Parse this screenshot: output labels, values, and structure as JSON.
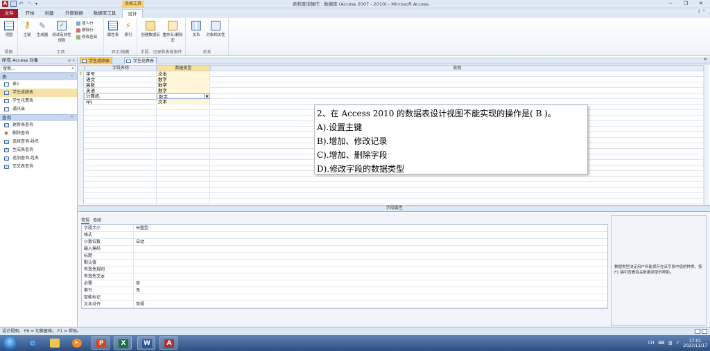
{
  "window": {
    "title": "表和查询操作 : 数据库 (Access 2007 - 2010) - Microsoft Access",
    "context_tab_group": "表格工具",
    "app_letter": "A"
  },
  "ribbon_tabs": [
    "文件",
    "开始",
    "创建",
    "外部数据",
    "数据库工具",
    "设计"
  ],
  "ribbon": {
    "groups": [
      {
        "label": "视图",
        "buttons": [
          "视图"
        ]
      },
      {
        "label": "工具",
        "buttons": [
          "主键",
          "生成器",
          "测试有效性规则"
        ],
        "small": [
          "插入行",
          "删除行",
          "修改查阅"
        ]
      },
      {
        "label": "显示/隐藏",
        "buttons": [
          "属性表",
          "索引"
        ]
      },
      {
        "label": "字段、记录和表格事件",
        "buttons": [
          "创建数据宏",
          "重命名/删除宏"
        ]
      },
      {
        "label": "关系",
        "buttons": [
          "关系",
          "对象相关性"
        ]
      }
    ]
  },
  "nav": {
    "header": "所有 Access 对象",
    "search_placeholder": "搜索...",
    "sections": [
      {
        "title": "表",
        "items": [
          "表1",
          "学生成绩表",
          "学生花费表",
          "通讯录"
        ],
        "selected": 1
      },
      {
        "title": "查询",
        "items": [
          "更新表查询",
          "删除查询",
          "选择查询-姓名",
          "生成表查询",
          "追加查询-姓名",
          "交叉表查询"
        ]
      }
    ]
  },
  "doc_tabs": [
    "学生成绩表",
    "学生花费表"
  ],
  "grid": {
    "headers": [
      "字段名称",
      "数据类型",
      "说明"
    ],
    "rows": [
      {
        "name": "学号",
        "type": "文本",
        "key": true
      },
      {
        "name": "语文",
        "type": "数字"
      },
      {
        "name": "高数",
        "type": "数字"
      },
      {
        "name": "英语",
        "type": "数字"
      },
      {
        "name": "计算机",
        "type": "数字",
        "current": true
      },
      {
        "name": "qq",
        "type": "文本"
      }
    ]
  },
  "question": {
    "lines": [
      "2、在 Access 2010  的数据表设计视图不能实现的操作是(    B    )。",
      "A).设置主键",
      "B).增加、修改记录",
      "C).增加、删除字段",
      "D).修改字段的数据类型"
    ]
  },
  "properties": {
    "bar_label": "字段属性",
    "tabs": [
      "常规",
      "查阅"
    ],
    "rows": [
      {
        "key": "字段大小",
        "value": "长整型"
      },
      {
        "key": "格式",
        "value": ""
      },
      {
        "key": "小数位数",
        "value": "自动"
      },
      {
        "key": "输入掩码",
        "value": ""
      },
      {
        "key": "标题",
        "value": ""
      },
      {
        "key": "默认值",
        "value": ""
      },
      {
        "key": "有效性规则",
        "value": ""
      },
      {
        "key": "有效性文本",
        "value": ""
      },
      {
        "key": "必需",
        "value": "否"
      },
      {
        "key": "索引",
        "value": "无"
      },
      {
        "key": "智能标记",
        "value": ""
      },
      {
        "key": "文本对齐",
        "value": "常规"
      }
    ],
    "help": "数据类型决定用户所能保存在该字段中值的种类。按 F1 键可查看有关数据类型的帮助。"
  },
  "status": {
    "text": "设计视图。 F6 = 切换窗格。 F1 = 帮助。"
  },
  "taskbar": {
    "apps": [
      "ie",
      "explorer",
      "media",
      "powerpoint",
      "excel",
      "word",
      "access"
    ],
    "tray_lang": "CH",
    "time": "17:01",
    "date": "2023/11/17"
  }
}
